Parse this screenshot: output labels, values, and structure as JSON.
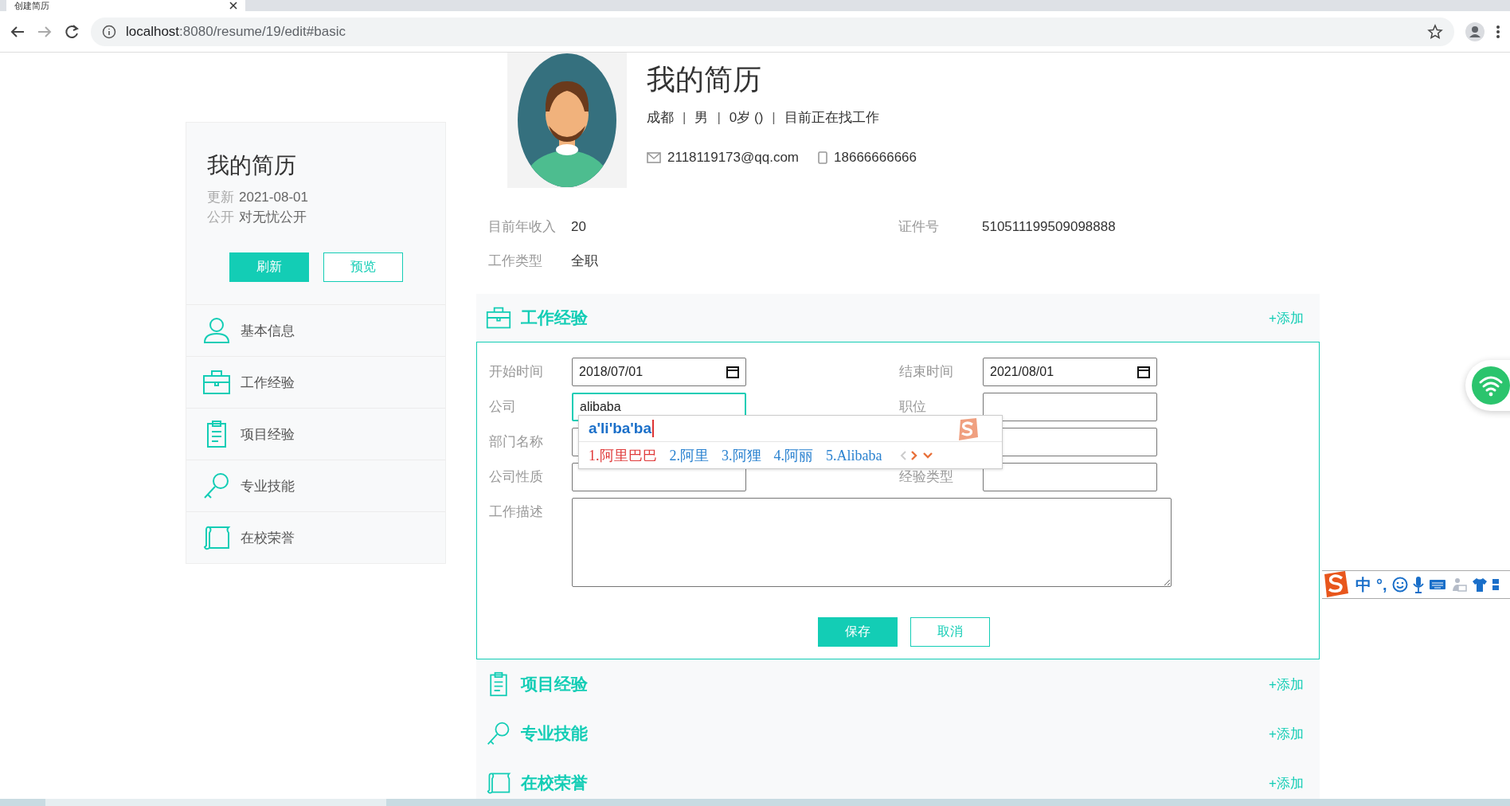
{
  "browser": {
    "tab_title": "创建简历",
    "url_host": "localhost",
    "url_rest": ":8080/resume/19/edit#basic"
  },
  "sidebar": {
    "title": "我的简历",
    "meta": [
      {
        "label": "更新",
        "value": "2021-08-01"
      },
      {
        "label": "公开",
        "value": "对无忧公开"
      }
    ],
    "buttons": [
      {
        "label": "刷新",
        "kind": "primary"
      },
      {
        "label": "预览",
        "kind": "outline"
      }
    ],
    "items": [
      {
        "label": "基本信息",
        "kind": "person"
      },
      {
        "label": "工作经验",
        "kind": "briefcase"
      },
      {
        "label": "项目经验",
        "kind": "clipboard"
      },
      {
        "label": "专业技能",
        "kind": "magnifier"
      },
      {
        "label": "在校荣誉",
        "kind": "scroll"
      }
    ]
  },
  "profile": {
    "name": "我的简历",
    "meta": [
      "成都",
      "男",
      "0岁 ()",
      "目前正在找工作"
    ],
    "separators": [
      "|",
      "|",
      "|"
    ],
    "email": "2118119173@qq.com",
    "phone": "18666666666"
  },
  "info": [
    {
      "label": "目前年收入",
      "value": "20"
    },
    {
      "label": "证件号",
      "value": "510511199509098888"
    },
    {
      "label": "工作类型",
      "value": "全职"
    }
  ],
  "sections": [
    {
      "title": "工作经验",
      "kind": "briefcase",
      "add": "+添加",
      "form": {
        "fields": [
          {
            "label": "开始时间",
            "kind": "date",
            "value": "2018/07/01"
          },
          {
            "label": "结束时间",
            "kind": "date",
            "value": "2021/08/01"
          },
          {
            "label": "公司",
            "kind": "text",
            "value": "alibaba",
            "focused": true
          },
          {
            "label": "职位",
            "kind": "text",
            "focused": false
          },
          {
            "label": "部门名称",
            "kind": "text",
            "focused": false
          },
          {
            "kind": "text",
            "focused": false
          },
          {
            "label": "公司性质",
            "kind": "text",
            "focused": false
          },
          {
            "label": "经验类型",
            "kind": "text",
            "focused": false
          },
          {
            "label": "工作描述",
            "kind": "textarea"
          }
        ],
        "buttons": [
          {
            "label": "保存",
            "kind": "primary"
          },
          {
            "label": "取消",
            "kind": "outline"
          }
        ]
      }
    },
    {
      "title": "项目经验",
      "kind": "clipboard",
      "add": "+添加"
    },
    {
      "title": "专业技能",
      "kind": "magnifier",
      "add": "+添加"
    },
    {
      "title": "在校荣誉",
      "kind": "scroll",
      "add": "+添加"
    }
  ],
  "ime_popup": {
    "composition": "a'li'ba'ba",
    "candidates": [
      {
        "text": "1.阿里巴巴",
        "selected": true
      },
      {
        "text": "2.阿里",
        "selected": false
      },
      {
        "text": "3.阿狸",
        "selected": false
      },
      {
        "text": "4.阿丽",
        "selected": false
      },
      {
        "text": "5.Alibaba",
        "selected": false
      }
    ]
  },
  "ime_toolbar": {
    "mode": "中",
    "punctuation": "°,"
  }
}
